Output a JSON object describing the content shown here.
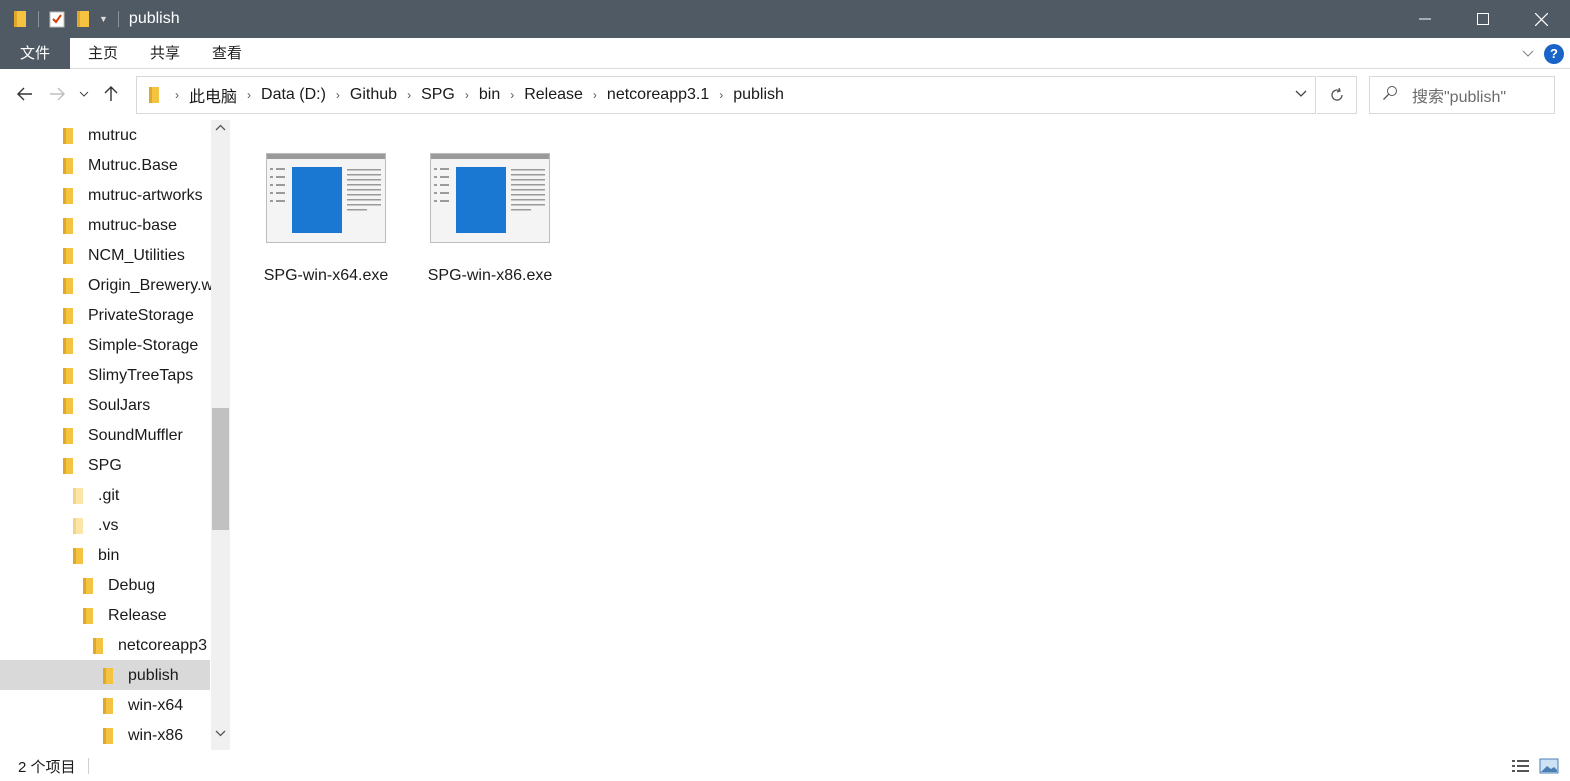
{
  "window": {
    "title": "publish"
  },
  "ribbon": {
    "tabs": [
      "文件",
      "主页",
      "共享",
      "查看"
    ]
  },
  "address": {
    "crumbs": [
      "此电脑",
      "Data (D:)",
      "Github",
      "SPG",
      "bin",
      "Release",
      "netcoreapp3.1",
      "publish"
    ]
  },
  "search": {
    "placeholder": "搜索\"publish\""
  },
  "nav": {
    "items": [
      {
        "label": "mutruc"
      },
      {
        "label": "Mutruc.Base"
      },
      {
        "label": "mutruc-artworks"
      },
      {
        "label": "mutruc-base"
      },
      {
        "label": "NCM_Utilities"
      },
      {
        "label": "Origin_Brewery.w"
      },
      {
        "label": "PrivateStorage"
      },
      {
        "label": "Simple-Storage"
      },
      {
        "label": "SlimyTreeTaps"
      },
      {
        "label": "SoulJars"
      },
      {
        "label": "SoundMuffler"
      },
      {
        "label": "SPG"
      },
      {
        "label": ".git"
      },
      {
        "label": ".vs"
      },
      {
        "label": "bin"
      },
      {
        "label": "Debug"
      },
      {
        "label": "Release"
      },
      {
        "label": "netcoreapp3"
      },
      {
        "label": "publish"
      },
      {
        "label": "win-x64"
      },
      {
        "label": "win-x86"
      }
    ]
  },
  "files": [
    {
      "name": "SPG-win-x64.exe"
    },
    {
      "name": "SPG-win-x86.exe"
    }
  ],
  "status": {
    "count": "2 个项目"
  },
  "colors": {
    "titlebar": "#505a64",
    "folder": "#f5c342",
    "selection": "#d9d9d9",
    "accent": "#1a64c8"
  }
}
